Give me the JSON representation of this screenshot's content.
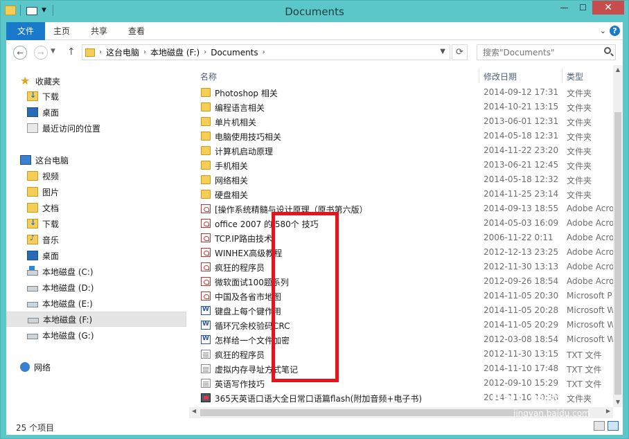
{
  "window": {
    "title": "Documents"
  },
  "title_buttons": {
    "minimize": "—",
    "maximize": "☐",
    "close": "✕"
  },
  "ribbon": {
    "tabs": [
      {
        "label": "文件"
      },
      {
        "label": "主页"
      },
      {
        "label": "共享"
      },
      {
        "label": "查看"
      }
    ],
    "help": "?"
  },
  "address": {
    "crumbs": [
      "这台电脑",
      "本地磁盘 (F:)",
      "Documents"
    ]
  },
  "search": {
    "placeholder": "搜索\"Documents\""
  },
  "sidebar": {
    "favorites": {
      "label": "收藏夹",
      "items": [
        {
          "label": "下载",
          "icon": "download-folder-icon"
        },
        {
          "label": "桌面",
          "icon": "desktop-icon"
        },
        {
          "label": "最近访问的位置",
          "icon": "recent-places-icon"
        }
      ]
    },
    "thispc": {
      "label": "这台电脑",
      "items": [
        {
          "label": "视频",
          "icon": "videos-folder-icon"
        },
        {
          "label": "图片",
          "icon": "pictures-folder-icon"
        },
        {
          "label": "文档",
          "icon": "documents-folder-icon"
        },
        {
          "label": "下载",
          "icon": "download-folder-icon"
        },
        {
          "label": "音乐",
          "icon": "music-folder-icon"
        },
        {
          "label": "桌面",
          "icon": "desktop-icon"
        },
        {
          "label": "本地磁盘 (C:)",
          "icon": "system-drive-icon"
        },
        {
          "label": "本地磁盘 (D:)",
          "icon": "drive-icon"
        },
        {
          "label": "本地磁盘 (E:)",
          "icon": "drive-icon"
        },
        {
          "label": "本地磁盘 (F:)",
          "icon": "drive-icon",
          "selected": true
        },
        {
          "label": "本地磁盘 (G:)",
          "icon": "drive-icon"
        }
      ]
    },
    "network": {
      "label": "网络"
    }
  },
  "columns": {
    "name": "名称",
    "date": "修改日期",
    "type": "类型"
  },
  "files": [
    {
      "name": "Photoshop 相关",
      "date": "2014-09-12 17:31",
      "type": "文件夹",
      "icon": "folder"
    },
    {
      "name": "编程语言相关",
      "date": "2014-10-21 13:15",
      "type": "文件夹",
      "icon": "folder"
    },
    {
      "name": "单片机相关",
      "date": "2013-06-01 12:31",
      "type": "文件夹",
      "icon": "folder"
    },
    {
      "name": "电脑使用技巧相关",
      "date": "2014-05-18 12:31",
      "type": "文件夹",
      "icon": "folder"
    },
    {
      "name": "计算机启动原理",
      "date": "2014-11-22 23:20",
      "type": "文件夹",
      "icon": "folder"
    },
    {
      "name": "手机相关",
      "date": "2013-06-21 12:45",
      "type": "文件夹",
      "icon": "folder"
    },
    {
      "name": "网络相关",
      "date": "2014-05-18 12:32",
      "type": "文件夹",
      "icon": "folder"
    },
    {
      "name": "硬盘相关",
      "date": "2014-11-25 23:14",
      "type": "文件夹",
      "icon": "folder"
    },
    {
      "name": "[操作系统精髓与设计原理（原书第六版）",
      "date": "2014-09-13 18:55",
      "type": "Adobe Acro",
      "icon": "pdf"
    },
    {
      "name": "office 2007 的 580个 技巧",
      "date": "2014-05-03 16:09",
      "type": "Adobe Acro",
      "icon": "pdf"
    },
    {
      "name": "TCP.IP路由技术",
      "date": "2006-11-22 0:11",
      "type": "Adobe Acro",
      "icon": "pdf"
    },
    {
      "name": "WINHEX高级教程",
      "date": "2012-12-13 23:25",
      "type": "Adobe Acro",
      "icon": "pdf"
    },
    {
      "name": "疯狂的程序员",
      "date": "2012-11-30 13:13",
      "type": "Adobe Acro",
      "icon": "pdf"
    },
    {
      "name": "微软面试100题系列",
      "date": "2012-09-26 18:54",
      "type": "Adobe Acro",
      "icon": "pdf"
    },
    {
      "name": "中国及各省市地图",
      "date": "2014-11-05 20:30",
      "type": "Microsoft P",
      "icon": "pdf"
    },
    {
      "name": "键盘上每个键作用",
      "date": "2014-11-05 20:28",
      "type": "Microsoft W",
      "icon": "word"
    },
    {
      "name": "循环冗余校验码CRC",
      "date": "2014-11-05 20:29",
      "type": "Microsoft W",
      "icon": "word"
    },
    {
      "name": "怎样给一个文件加密",
      "date": "2012-03-08 18:54",
      "type": "Microsoft W",
      "icon": "word"
    },
    {
      "name": "疯狂的程序员",
      "date": "2012-11-30 13:15",
      "type": "TXT 文件",
      "icon": "txt"
    },
    {
      "name": "虚拟内存寻址方式笔记",
      "date": "2014-11-10 17:48",
      "type": "TXT 文件",
      "icon": "txt"
    },
    {
      "name": "英语写作技巧",
      "date": "2012-09-10 15:29",
      "type": "TXT 文件",
      "icon": "txt"
    },
    {
      "name": "365天英语口语大全日常口语篇flash(附加音频+电子书)",
      "date": "2014-11-10 10:38",
      "type": "文件夹",
      "icon": "flash"
    }
  ],
  "status": {
    "count": "25 个项目"
  },
  "watermark": {
    "line1": "Bai 经验",
    "line2": "jingyan.baidu.com"
  }
}
